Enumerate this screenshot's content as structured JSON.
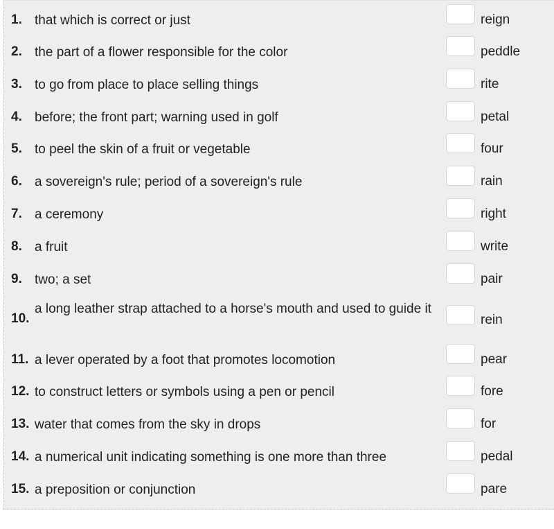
{
  "items": [
    {
      "number": "1.",
      "definition": "that which is correct or just",
      "word": "reign",
      "answer": ""
    },
    {
      "number": "2.",
      "definition": "the part of a flower responsible for the color",
      "word": "peddle",
      "answer": ""
    },
    {
      "number": "3.",
      "definition": "to go from place to place selling things",
      "word": "rite",
      "answer": ""
    },
    {
      "number": "4.",
      "definition": "before; the front part; warning used in golf",
      "word": "petal",
      "answer": ""
    },
    {
      "number": "5.",
      "definition": "to peel the skin of a fruit or vegetable",
      "word": "four",
      "answer": ""
    },
    {
      "number": "6.",
      "definition": "a sovereign's rule; period of a sovereign's rule",
      "word": "rain",
      "answer": ""
    },
    {
      "number": "7.",
      "definition": "a ceremony",
      "word": "right",
      "answer": ""
    },
    {
      "number": "8.",
      "definition": "a fruit",
      "word": "write",
      "answer": ""
    },
    {
      "number": "9.",
      "definition": "two; a set",
      "word": "pair",
      "answer": ""
    },
    {
      "number": "10.",
      "definition": "a long leather strap attached to a horse's mouth and used to guide it",
      "word": "rein",
      "answer": ""
    },
    {
      "number": "11.",
      "definition": "a lever operated by a foot that promotes locomotion",
      "word": "pear",
      "answer": ""
    },
    {
      "number": "12.",
      "definition": "to construct letters or symbols using a pen or pencil",
      "word": "fore",
      "answer": ""
    },
    {
      "number": "13.",
      "definition": "water that comes from the sky in drops",
      "word": "for",
      "answer": ""
    },
    {
      "number": "14.",
      "definition": "a numerical unit indicating something is one more than three",
      "word": "pedal",
      "answer": ""
    },
    {
      "number": "15.",
      "definition": "a preposition or conjunction",
      "word": "pare",
      "answer": ""
    }
  ]
}
